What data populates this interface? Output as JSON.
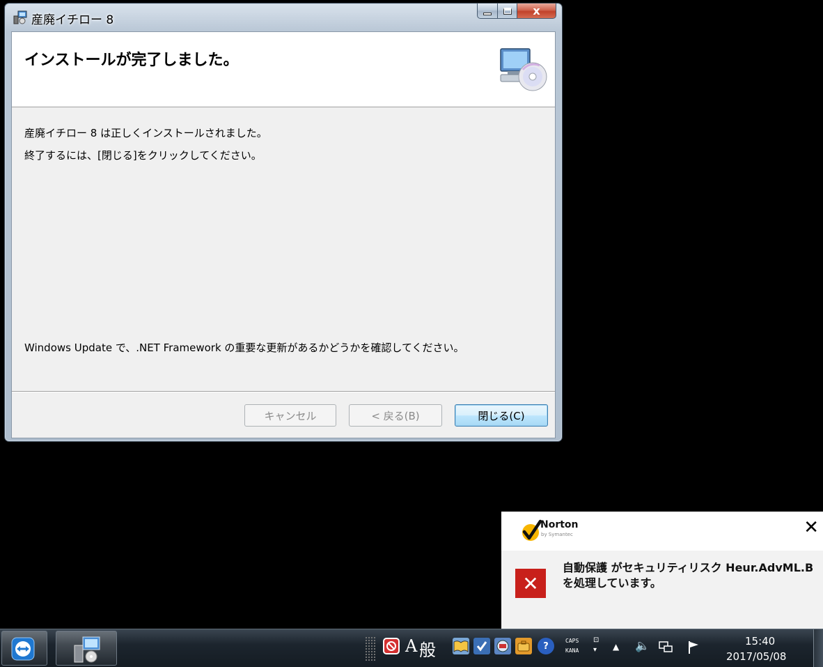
{
  "window": {
    "title": "産廃イチロー 8",
    "close_glyph": "x"
  },
  "banner": {
    "title": "インストールが完了しました。",
    "icon": "computer-cd-icon"
  },
  "body": {
    "line1": "産廃イチロー 8 は正しくインストールされました。",
    "line2": "終了するには、[閉じる]をクリックしてください。",
    "line3": "Windows Update で、.NET Framework の重要な更新があるかどうかを確認してください。"
  },
  "buttons": {
    "cancel": "キャンセル",
    "back": "< 戻る(B)",
    "close": "閉じる(C)"
  },
  "toast": {
    "brand": "Norton",
    "brand_sub": "by Symantec",
    "close_glyph": "✕",
    "alert_icon": "✕",
    "message_line1": "自動保護 がセキュリティリスク Heur.AdvML.B",
    "message_line2": "を処理しています。",
    "alert_color": "#c8201b"
  },
  "taskbar": {
    "ime_mode": "A",
    "ime_kanji": "般",
    "caps": "CAPS",
    "kana": "KANA",
    "help_glyph": "?",
    "time": "15:40",
    "date": "2017/05/08"
  }
}
